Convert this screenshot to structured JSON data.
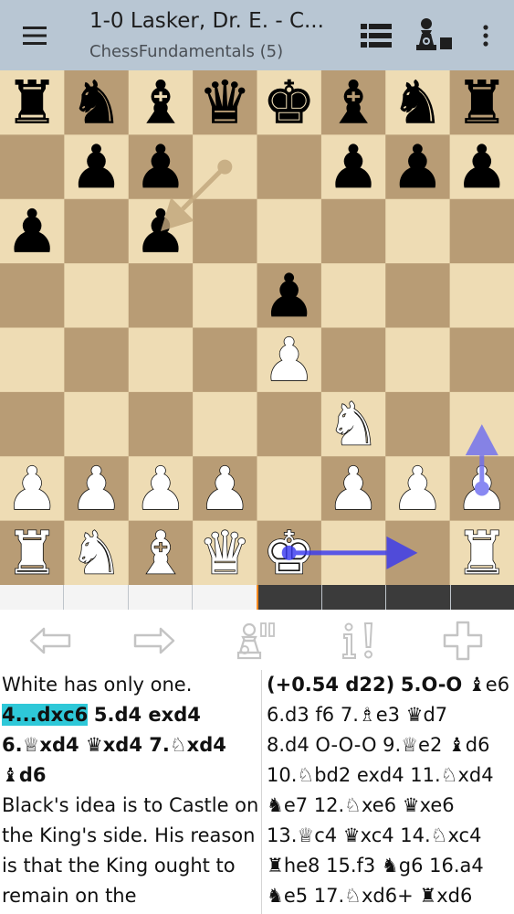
{
  "toolbar": {
    "title": "1-0 Lasker, Dr. E. - C...",
    "subtitle": "ChessFundamentals (5)",
    "menu_icon": "hamburger-menu-icon",
    "list_icon": "move-list-icon",
    "engine_icon": "engine-pawn-icon",
    "more_icon": "more-vertical-icon"
  },
  "board": {
    "light_color": "#eedcb4",
    "dark_color": "#b89c75",
    "pieces": [
      "rnbqkbnr",
      ".pp..ppp",
      "p.p.....",
      "....p...",
      "....P...",
      ".....N..",
      "PPPP.PPP",
      "RNBQK..R"
    ],
    "arrows": [
      {
        "from": "d7",
        "to": "c6",
        "color": "#c2a77d"
      },
      {
        "from": "e1",
        "to": "g1",
        "color": "#3a3af0"
      },
      {
        "from": "h2",
        "to": "h3",
        "color": "#6f6ff0"
      }
    ]
  },
  "progress": {
    "segments": 8,
    "filled": 4,
    "light_color": "#f4f4f4",
    "dark_color": "#3b3b3b",
    "marker_color": "#ff8a1e"
  },
  "nav": {
    "back_icon": "arrow-left-icon",
    "forward_icon": "arrow-right-icon",
    "engine_toggle_icon": "pawn-gear-icon",
    "annotate_icon": "info-exclamation-icon",
    "add_icon": "plus-icon"
  },
  "comment": {
    "line1": "White has only one.",
    "move_hl": "4...dxc6",
    "m5": "5.d4 exd4",
    "m6": "6.♕xd4 ♛xd4 7.♘xd4",
    "m7b": "♝d6",
    "text": "Black's idea is to Castle on the King's side. His reason is that the King ought to remain on the"
  },
  "moves": {
    "eval": "(+0.54 d22)",
    "m5": "5.O-O",
    "after5": "♝e6",
    "line2": "6.d3 f6 7.♗e3 ♛d7",
    "line3": "8.d4 O-O-O 9.♕e2 ♝d6",
    "line4": "10.♘bd2 exd4 11.♘xd4",
    "line5": "♞e7 12.♘xe6 ♛xe6",
    "line6": "13.♕c4 ♛xc4 14.♘xc4",
    "line7": "♜he8 15.f3 ♞g6 16.a4",
    "line8": "♞e5 17.♘xd6+ ♜xd6"
  }
}
